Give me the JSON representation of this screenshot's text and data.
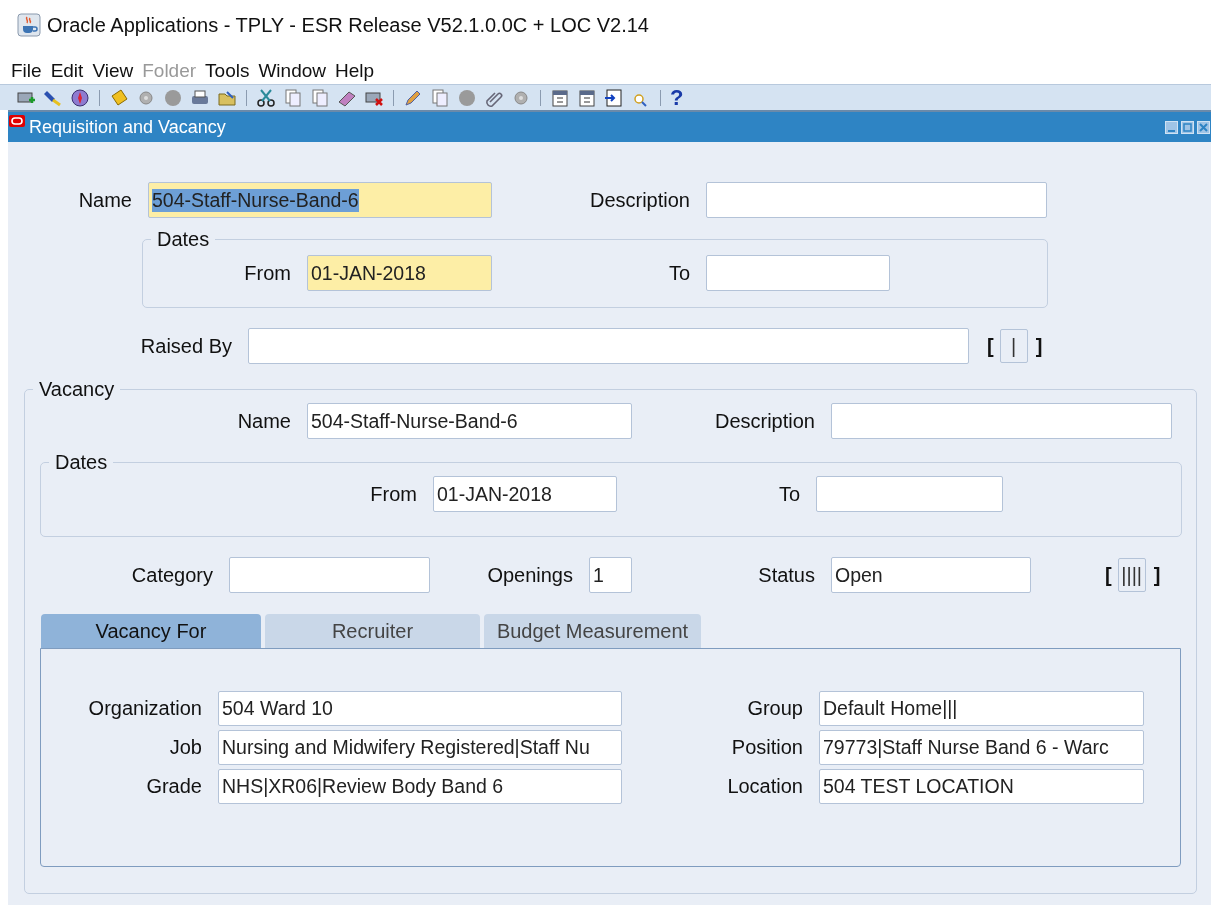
{
  "window": {
    "title": "Oracle Applications - TPLY - ESR Release V52.1.0.0C + LOC V2.14"
  },
  "menu": [
    {
      "label": "File",
      "disabled": false
    },
    {
      "label": "Edit",
      "disabled": false
    },
    {
      "label": "View",
      "disabled": false
    },
    {
      "label": "Folder",
      "disabled": true
    },
    {
      "label": "Tools",
      "disabled": false
    },
    {
      "label": "Window",
      "disabled": false
    },
    {
      "label": "Help",
      "disabled": false
    }
  ],
  "toolbar": {
    "help": "?"
  },
  "form": {
    "title": "Requisition and Vacancy",
    "requisition": {
      "name": {
        "label": "Name",
        "value": "504-Staff-Nurse-Band-6",
        "required": true,
        "text_selected": true
      },
      "description": {
        "label": "Description"
      },
      "dates": {
        "legend": "Dates",
        "from": {
          "label": "From",
          "value": "01-JAN-2018",
          "required": true
        },
        "to": {
          "label": "To"
        }
      },
      "raised_by": {
        "label": "Raised By"
      },
      "flex": {
        "open": "[",
        "value": "|",
        "close": "]"
      }
    },
    "vacancy": {
      "legend": "Vacancy",
      "name": {
        "label": "Name",
        "value": "504-Staff-Nurse-Band-6"
      },
      "description": {
        "label": "Description"
      },
      "dates": {
        "legend": "Dates",
        "from": {
          "label": "From",
          "value": "01-JAN-2018"
        },
        "to": {
          "label": "To"
        }
      },
      "category": {
        "label": "Category"
      },
      "openings": {
        "label": "Openings",
        "value": "1"
      },
      "status": {
        "label": "Status",
        "value": "Open"
      },
      "flex": {
        "open": "[",
        "value": "||||",
        "close": "]"
      }
    },
    "tabs": [
      {
        "label": "Vacancy For",
        "selected": true
      },
      {
        "label": "Recruiter",
        "selected": false
      },
      {
        "label": "Budget Measurement",
        "selected": false
      }
    ],
    "vacancy_for": {
      "rows": [
        {
          "left": {
            "label": "Organization",
            "value": "504 Ward 10"
          },
          "right": {
            "label": "Group",
            "value": "Default Home|||"
          }
        },
        {
          "left": {
            "label": "Job",
            "value": "Nursing and Midwifery Registered|Staff Nu"
          },
          "right": {
            "label": "Position",
            "value": "79773|Staff Nurse Band 6 -  Warc"
          }
        },
        {
          "left": {
            "label": "Grade",
            "value": "NHS|XR06|Review Body Band 6"
          },
          "right": {
            "label": "Location",
            "value": "504 TEST LOCATION"
          }
        }
      ]
    }
  }
}
